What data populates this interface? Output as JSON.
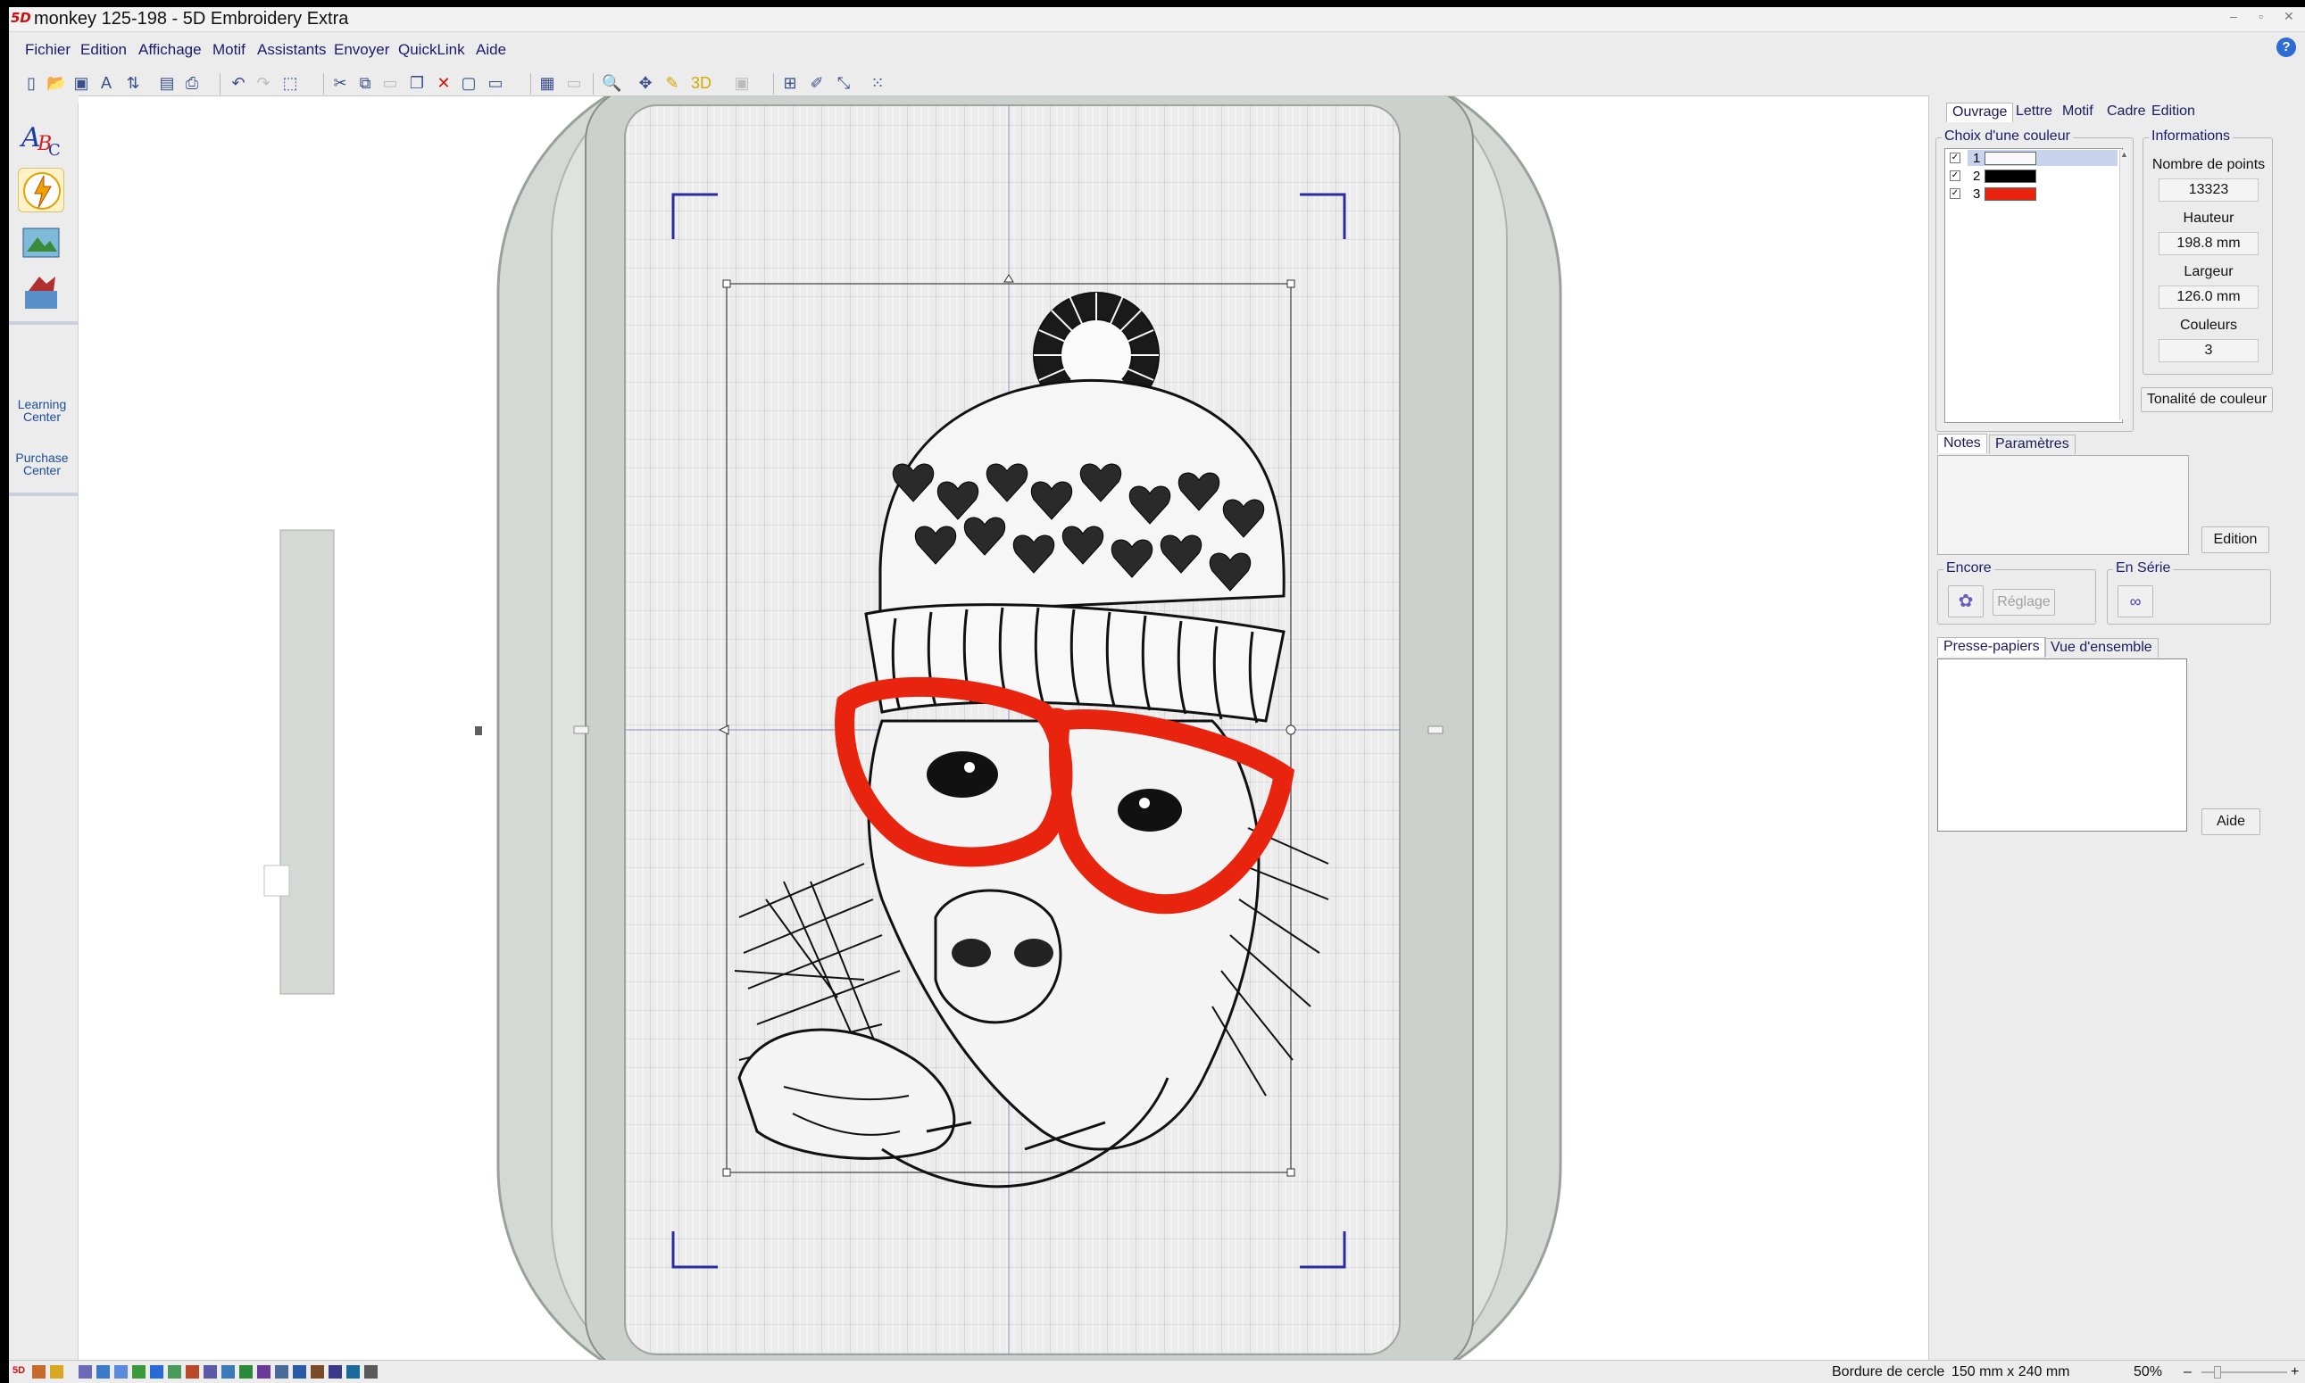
{
  "window": {
    "app_logo": "5D",
    "title": "monkey 125-198 - 5D Embroidery Extra",
    "controls": [
      "–",
      "▫",
      "✕"
    ]
  },
  "menu": [
    "Fichier",
    "Edition",
    "Affichage",
    "Motif",
    "Assistants",
    "Envoyer",
    "QuickLink",
    "Aide"
  ],
  "help_icon": "?",
  "launcher": {
    "learning_center": "Learning Center",
    "purchase_center": "Purchase Center"
  },
  "right_panel": {
    "tabs": [
      "Ouvrage",
      "Lettre",
      "Motif",
      "Cadre",
      "Edition"
    ],
    "color_group_label": "Choix d'une couleur",
    "colors": [
      {
        "index": "1",
        "hex": "#f8f8f8",
        "checked": true
      },
      {
        "index": "2",
        "hex": "#000000",
        "checked": true
      },
      {
        "index": "3",
        "hex": "#e8230e",
        "checked": true
      }
    ],
    "info_group_label": "Informations",
    "info": [
      {
        "label": "Nombre de points",
        "value": "13323"
      },
      {
        "label": "Hauteur",
        "value": "198.8 mm"
      },
      {
        "label": "Largeur",
        "value": "126.0 mm"
      },
      {
        "label": "Couleurs",
        "value": "3"
      }
    ],
    "tonalite_button": "Tonalité de couleur",
    "notes_tabs": [
      "Notes",
      "Paramètres"
    ],
    "edition_button": "Edition",
    "encore_label": "Encore",
    "reglage_button": "Réglage",
    "en_serie_label": "En Série",
    "clipboard_tabs": [
      "Presse-papiers",
      "Vue d'ensemble"
    ],
    "aide_button": "Aide"
  },
  "status": {
    "hoop": "Bordure de cercle",
    "hoop_size": "150 mm x 240 mm",
    "zoom": "50%",
    "zoom_minus": "–",
    "zoom_plus": "+"
  },
  "colors": {
    "hoop_frame": "#d5d9d5",
    "grid_fabric": "#ececec",
    "glasses_red": "#e8230e",
    "corner_marks": "#2b2ba0"
  }
}
